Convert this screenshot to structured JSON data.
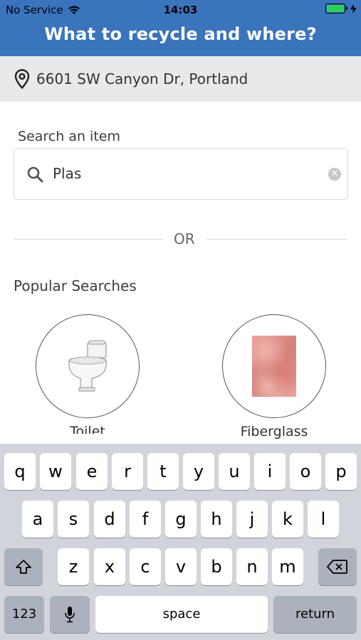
{
  "status_bar": {
    "carrier": "No Service",
    "time": "14:03"
  },
  "header": {
    "title": "What to recycle and where?"
  },
  "location": {
    "address": "6601 SW Canyon Dr, Portland",
    "icon": "location-pin-icon"
  },
  "search": {
    "label": "Search an item",
    "value": "Plas"
  },
  "divider": {
    "text": "OR"
  },
  "popular": {
    "title": "Popular Searches",
    "items": [
      {
        "label": "Toilet",
        "icon": "toilet-icon"
      },
      {
        "label": "Fiberglass",
        "icon": "fiberglass-image"
      }
    ]
  },
  "keyboard": {
    "row1": [
      "q",
      "w",
      "e",
      "r",
      "t",
      "y",
      "u",
      "i",
      "o",
      "p"
    ],
    "row2": [
      "a",
      "s",
      "d",
      "f",
      "g",
      "h",
      "j",
      "k",
      "l"
    ],
    "row3": [
      "z",
      "x",
      "c",
      "v",
      "b",
      "n",
      "m"
    ],
    "numbers_key": "123",
    "space_key": "space",
    "return_key": "return"
  },
  "colors": {
    "header_bg": "#3a74bd",
    "location_bg": "#e9e9ea",
    "keyboard_bg": "#d1d4da"
  }
}
